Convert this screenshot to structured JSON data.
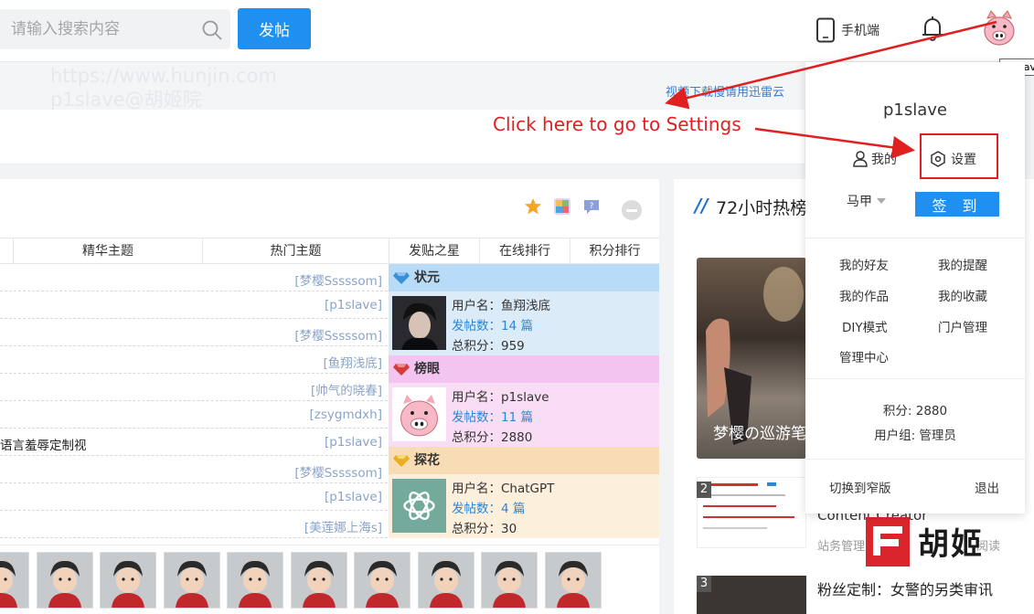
{
  "search": {
    "placeholder": "请输入搜索内容"
  },
  "header": {
    "post_label": "发帖",
    "mobile_label": "手机端",
    "tooltip_user": "p1slave"
  },
  "banner": {
    "watermark_line1": "https://www.hunjin.com",
    "watermark_line2": "p1slave@胡姬院",
    "tip": "视频下载慢请用迅雷云"
  },
  "annotation": {
    "text": "Click here to go to Settings"
  },
  "tabs": [
    "精华主题",
    "热门主题",
    "发贴之星",
    "在线排行",
    "积分排行"
  ],
  "thread_list": [
    {
      "title": "",
      "author": "[梦樱Sssssom]"
    },
    {
      "title": "",
      "author": "[p1slave]"
    },
    {
      "title": "",
      "author": "[梦樱Sssssom]"
    },
    {
      "title": "",
      "author": "[鱼翔浅底]"
    },
    {
      "title": "",
      "author": "[帅气的晓春]"
    },
    {
      "title": "",
      "author": "[zsygmdxh]"
    },
    {
      "title": "语言羞辱定制视",
      "author": "[p1slave]"
    },
    {
      "title": "",
      "author": "[梦樱Sssssom]"
    },
    {
      "title": "",
      "author": "[p1slave]"
    },
    {
      "title": "",
      "author": "[美莲娜上海s]"
    }
  ],
  "ranking": [
    {
      "rank_label": "状元",
      "username_label": "用户名：",
      "username": "鱼翔浅底",
      "posts_label": "发帖数：",
      "posts": "14 篇",
      "score_label": "总积分：",
      "score": "959",
      "head_color": "#b8dcf7",
      "body_color": "#dcebf8"
    },
    {
      "rank_label": "榜眼",
      "username_label": "用户名：",
      "username": "p1slave",
      "posts_label": "发帖数：",
      "posts": "11 篇",
      "score_label": "总积分：",
      "score": "2880",
      "head_color": "#f3c4ef",
      "body_color": "#f8ddf4"
    },
    {
      "rank_label": "探花",
      "username_label": "用户名：",
      "username": "ChatGPT",
      "posts_label": "发帖数：",
      "posts": "4 篇",
      "score_label": "总积分：",
      "score": "30",
      "head_color": "#f8dcb6",
      "body_color": "#fcefdb"
    }
  ],
  "hot": {
    "title": "72小时热榜",
    "item1_caption": "梦樱の巡游笔",
    "item2_title": "Content Creator",
    "item2_meta": "站务管理",
    "item2_read": "阅读",
    "item3_title": "粉丝定制：女警的另类审讯",
    "thumb_numbers": [
      "2",
      "3"
    ]
  },
  "logo": {
    "text": "胡姬"
  },
  "user_menu": {
    "username": "p1slave",
    "my_label": "我的",
    "settings_label": "设置",
    "vest_label": "马甲",
    "checkin_label": "签 到",
    "links": [
      "我的好友",
      "我的提醒",
      "我的作品",
      "我的收藏",
      "DIY模式",
      "门户管理",
      "管理中心"
    ],
    "score": "积分: 2880",
    "group": "用户组: 管理员",
    "switch_label": "切换到窄版",
    "logout_label": "退出"
  },
  "colors": {
    "accent": "#1f8ff0",
    "annotation": "#e02020",
    "link": "#2b86d6"
  }
}
